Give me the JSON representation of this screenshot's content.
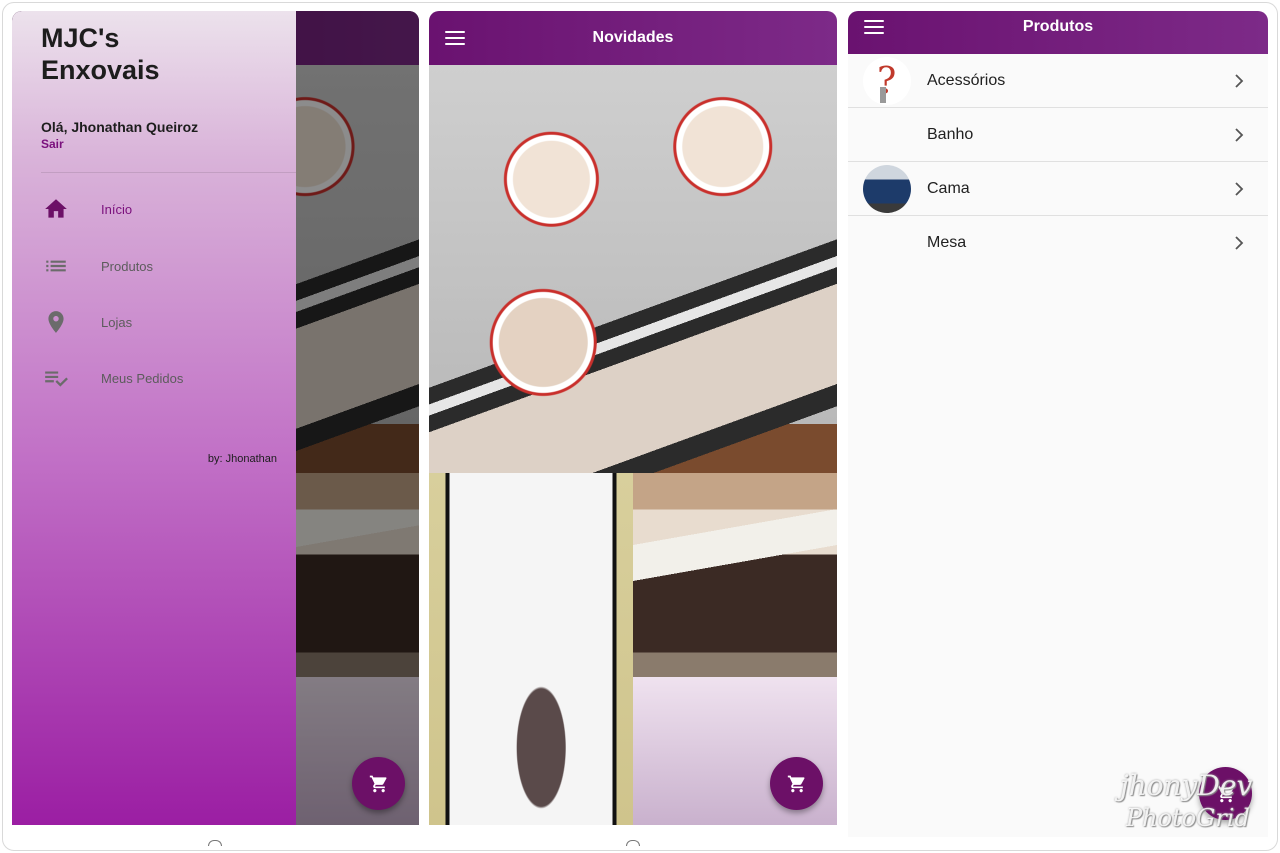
{
  "drawer": {
    "title": "MJC's Enxovais",
    "greeting": "Olá, Jhonathan Queiroz",
    "logout": "Sair",
    "items": [
      {
        "label": "Início",
        "icon": "home-icon",
        "active": true
      },
      {
        "label": "Produtos",
        "icon": "list-icon",
        "active": false
      },
      {
        "label": "Lojas",
        "icon": "location-pin-icon",
        "active": false
      },
      {
        "label": "Meus Pedidos",
        "icon": "playlist-check-icon",
        "active": false
      }
    ],
    "footer": "by: Jhonathan"
  },
  "novidades": {
    "title": "Novidades"
  },
  "produtos": {
    "title": "Produtos",
    "categories": [
      {
        "label": "Acessórios",
        "icon": "question-mark-image"
      },
      {
        "label": "Banho",
        "icon": ""
      },
      {
        "label": "Cama",
        "icon": "bed-image"
      },
      {
        "label": "Mesa",
        "icon": ""
      }
    ]
  },
  "colors": {
    "primary": "#6c1067",
    "accent": "#7a0f7c"
  },
  "watermark": {
    "line1": "jhonyDev",
    "line2": "PhotoGrid"
  }
}
